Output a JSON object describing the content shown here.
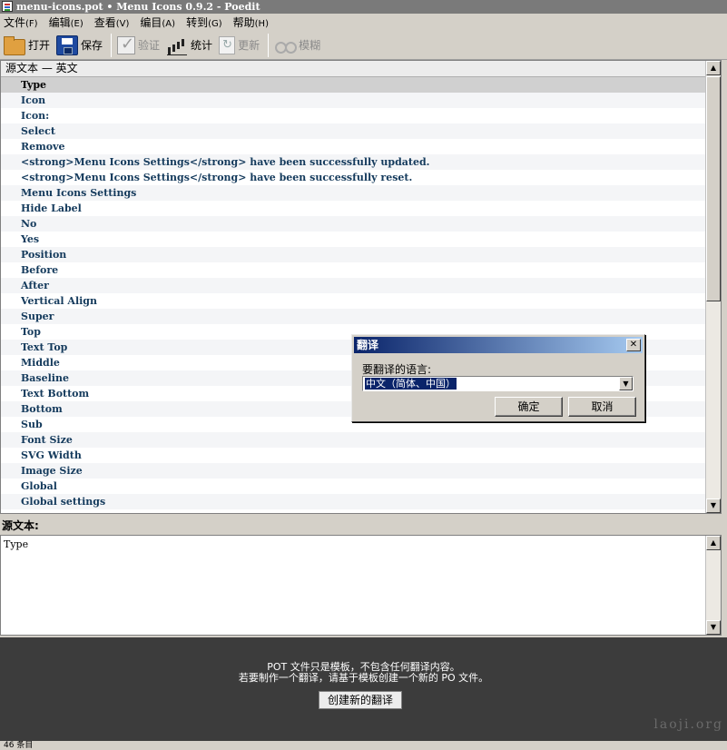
{
  "window": {
    "title": "menu-icons.pot • Menu Icons 0.9.2 - Poedit"
  },
  "menubar": [
    {
      "label": "文件",
      "hotkey": "(F)"
    },
    {
      "label": "编辑",
      "hotkey": "(E)"
    },
    {
      "label": "查看",
      "hotkey": "(V)"
    },
    {
      "label": "编目",
      "hotkey": "(A)"
    },
    {
      "label": "转到",
      "hotkey": "(G)"
    },
    {
      "label": "帮助",
      "hotkey": "(H)"
    }
  ],
  "toolbar": {
    "open": "打开",
    "save": "保存",
    "validate": "验证",
    "stats": "统计",
    "update": "更新",
    "fuzzy": "模糊"
  },
  "list": {
    "header": "源文本 — 英文",
    "rows": [
      "Type",
      "Icon",
      "Icon:",
      "Select",
      "Remove",
      "<strong>Menu Icons Settings</strong> have been successfully updated.",
      "<strong>Menu Icons Settings</strong> have been successfully reset.",
      "Menu Icons Settings",
      "Hide Label",
      "No",
      "Yes",
      "Position",
      "Before",
      "After",
      "Vertical Align",
      "Super",
      "Top",
      "Text Top",
      "Middle",
      "Baseline",
      "Text Bottom",
      "Bottom",
      "Sub",
      "Font Size",
      "SVG Width",
      "Image Size",
      "Global",
      "Global settings"
    ],
    "selected_index": 0
  },
  "source": {
    "label": "源文本:",
    "text": "Type"
  },
  "notice": {
    "line1": "POT 文件只是模板，不包含任何翻译内容。",
    "line2": "若要制作一个翻译，请基于模板创建一个新的 PO 文件。",
    "create_button": "创建新的翻译",
    "watermark": "laoji.org"
  },
  "statusbar": {
    "text": "46 条目"
  },
  "dialog": {
    "title": "翻译",
    "close": "✕",
    "label": "要翻译的语言:",
    "selected_language": "中文（简体、中国）",
    "ok": "确定",
    "cancel": "取消"
  },
  "icons": {
    "open": "folder-icon",
    "save": "floppy-icon",
    "validate": "checkmark-icon",
    "stats": "bar-chart-icon",
    "update": "refresh-icon",
    "fuzzy": "glasses-icon"
  }
}
